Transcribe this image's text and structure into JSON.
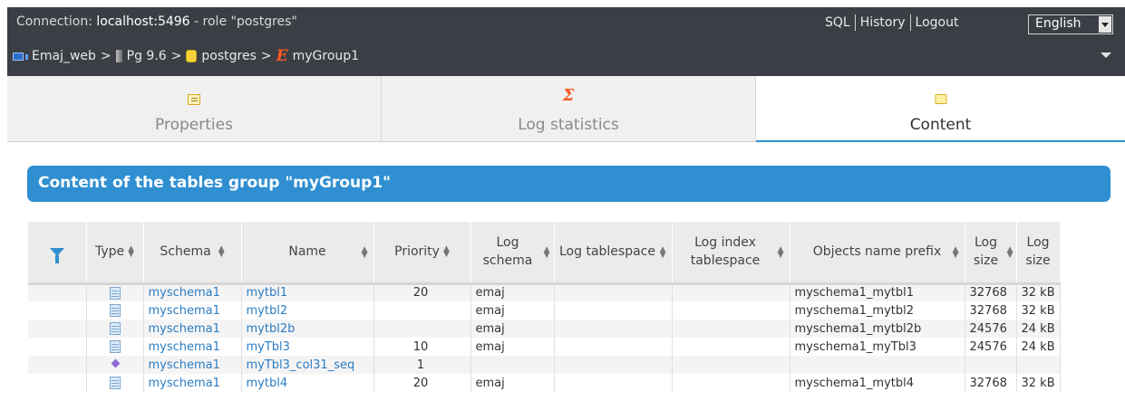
{
  "connection": {
    "prefix": "Connection: ",
    "host": "localhost:5496",
    "role": " - role \"postgres\""
  },
  "toplinks": [
    "SQL",
    "History",
    "Logout"
  ],
  "language": {
    "selected": "English"
  },
  "breadcrumb": {
    "items": [
      "Emaj_web",
      "Pg 9.6",
      "postgres",
      "myGroup1"
    ],
    "separator": ">"
  },
  "tabs": [
    {
      "label": "Properties",
      "icon": "properties-icon",
      "active": false
    },
    {
      "label": "Log statistics",
      "icon": "sigma-icon",
      "active": false
    },
    {
      "label": "Content",
      "icon": "folder-icon",
      "active": true
    }
  ],
  "section_title": "Content of the tables group \"myGroup1\"",
  "table": {
    "headers": [
      {
        "label": "",
        "icon": "filter-icon"
      },
      {
        "label": "Type"
      },
      {
        "label": "Schema"
      },
      {
        "label": "Name"
      },
      {
        "label": "Priority"
      },
      {
        "label": "Log schema"
      },
      {
        "label": "Log tablespace"
      },
      {
        "label": "Log index tablespace"
      },
      {
        "label": "Objects name prefix"
      },
      {
        "label": "Log size"
      },
      {
        "label": "Log size"
      }
    ],
    "rows": [
      {
        "type": "table-icon",
        "schema": "myschema1",
        "name": "mytbl1",
        "priority": "20",
        "log_schema": "emaj",
        "log_tablespace": "",
        "log_index_tablespace": "",
        "prefix": "myschema1_mytbl1",
        "log_size": "32768",
        "log_size_pretty": "32 kB"
      },
      {
        "type": "table-icon",
        "schema": "myschema1",
        "name": "mytbl2",
        "priority": "",
        "log_schema": "emaj",
        "log_tablespace": "",
        "log_index_tablespace": "",
        "prefix": "myschema1_mytbl2",
        "log_size": "32768",
        "log_size_pretty": "32 kB"
      },
      {
        "type": "table-icon",
        "schema": "myschema1",
        "name": "mytbl2b",
        "priority": "",
        "log_schema": "emaj",
        "log_tablespace": "",
        "log_index_tablespace": "",
        "prefix": "myschema1_mytbl2b",
        "log_size": "24576",
        "log_size_pretty": "24 kB"
      },
      {
        "type": "table-icon",
        "schema": "myschema1",
        "name": "myTbl3",
        "priority": "10",
        "log_schema": "emaj",
        "log_tablespace": "",
        "log_index_tablespace": "",
        "prefix": "myschema1_myTbl3",
        "log_size": "24576",
        "log_size_pretty": "24 kB"
      },
      {
        "type": "sequence-icon",
        "schema": "myschema1",
        "name": "myTbl3_col31_seq",
        "priority": "1",
        "log_schema": "",
        "log_tablespace": "",
        "log_index_tablespace": "",
        "prefix": "",
        "log_size": "",
        "log_size_pretty": ""
      },
      {
        "type": "table-icon",
        "schema": "myschema1",
        "name": "mytbl4",
        "priority": "20",
        "log_schema": "emaj",
        "log_tablespace": "",
        "log_index_tablespace": "",
        "prefix": "myschema1_mytbl4",
        "log_size": "32768",
        "log_size_pretty": "32 kB"
      }
    ]
  },
  "colors": {
    "accent": "#2f8fd1",
    "header_bg": "#3b3f45",
    "link": "#2b7cc4",
    "emaj_orange": "#ff5a1f"
  }
}
